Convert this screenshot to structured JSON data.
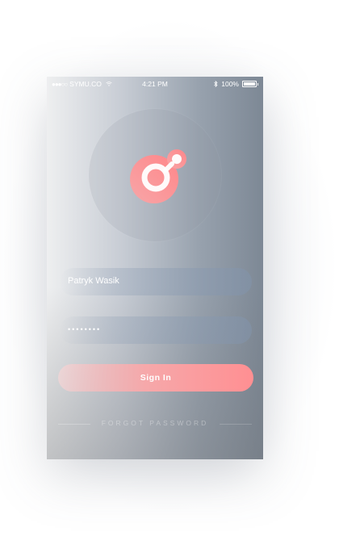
{
  "status_bar": {
    "signal": "●●●○○",
    "carrier": "SYMU.CO",
    "time": "4:21 PM",
    "battery": "100%"
  },
  "icons": {
    "app_logo": "logo-icon",
    "wifi": "wifi-icon",
    "bluetooth": "bluetooth-icon",
    "battery": "battery-icon"
  },
  "form": {
    "username_label": "",
    "username_value": "Patryk Wasik",
    "password_label": "",
    "password_value": "••••••••"
  },
  "actions": {
    "signin_label": "Sign In",
    "forgot_label": "FORGOT PASSWORD"
  },
  "colors": {
    "accent": "#ff8f92",
    "accent_light": "#f6a8aa"
  }
}
